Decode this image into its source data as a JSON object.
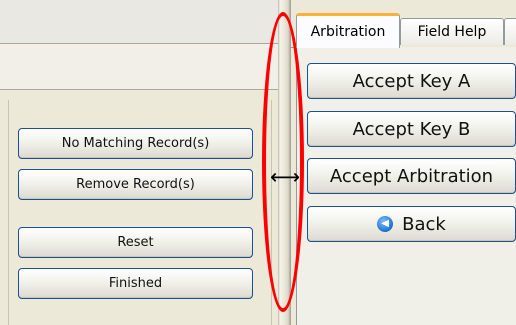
{
  "tabs": [
    {
      "label": "Arbitration",
      "active": true
    },
    {
      "label": "Field Help",
      "active": false
    }
  ],
  "left_buttons": {
    "no_matching": "No Matching Record(s)",
    "remove": "Remove Record(s)",
    "reset": "Reset",
    "finished": "Finished"
  },
  "right_buttons": {
    "accept_key_a": "Accept Key A",
    "accept_key_b": "Accept Key B",
    "accept_arbitration": "Accept Arbitration",
    "back": "Back"
  },
  "cursor": {
    "symbol": "⟷",
    "icon": "horizontal-resize-cursor"
  },
  "annotation": {
    "color": "#ff0000",
    "shape": "oval-highlight"
  },
  "icons": {
    "back": "back-arrow-circle-icon"
  },
  "colors": {
    "button_border": "#1d4f94",
    "active_tab_accent": "#f8b23c"
  }
}
